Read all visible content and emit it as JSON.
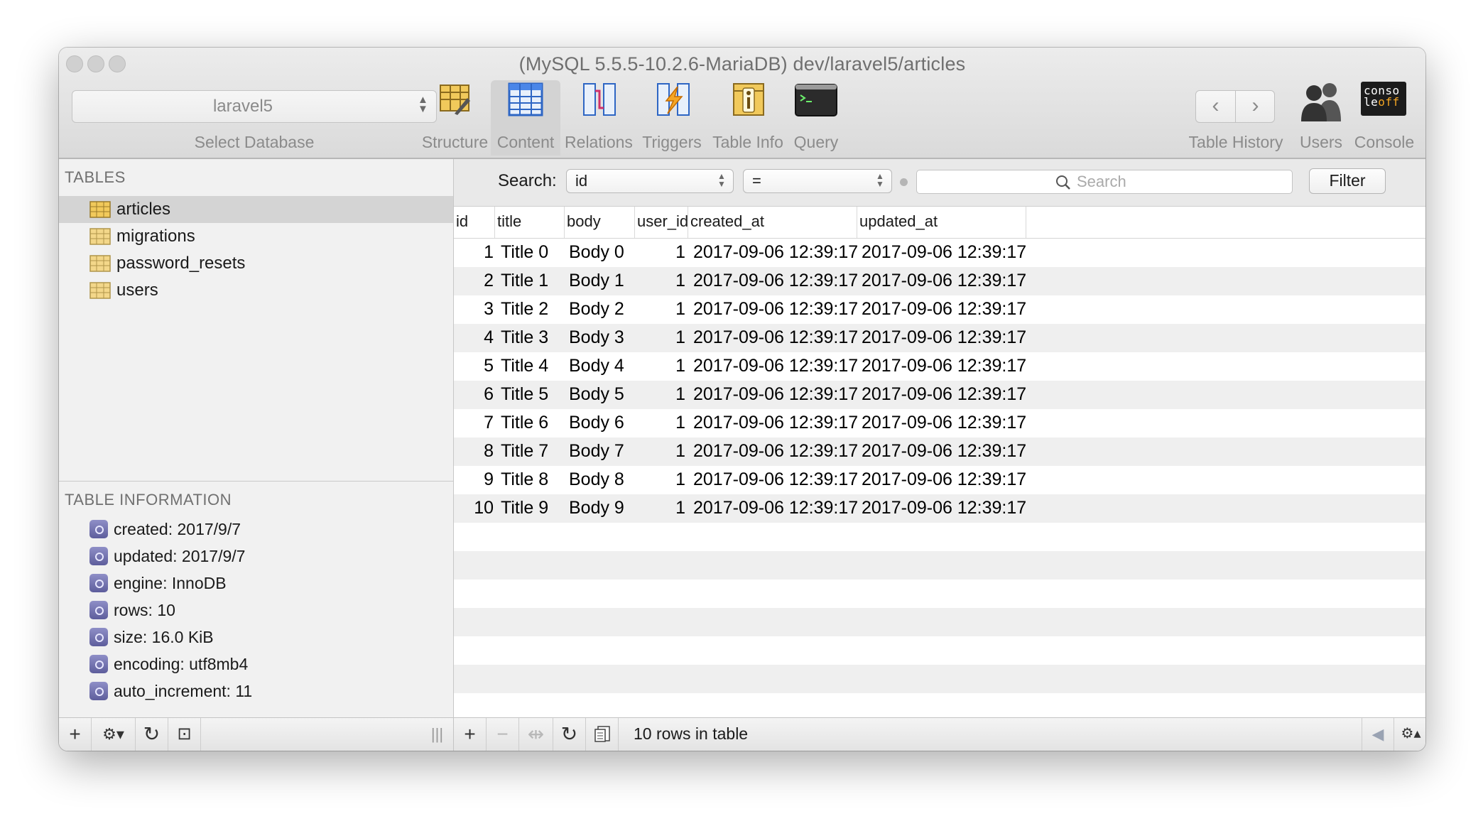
{
  "window": {
    "title": "(MySQL 5.5.5-10.2.6-MariaDB) dev/laravel5/articles"
  },
  "database": {
    "selected": "laravel5",
    "label": "Select Database"
  },
  "toolbar": {
    "items": [
      {
        "label": "Structure",
        "icon": "structure-icon"
      },
      {
        "label": "Content",
        "icon": "content-icon"
      },
      {
        "label": "Relations",
        "icon": "relations-icon"
      },
      {
        "label": "Triggers",
        "icon": "triggers-icon"
      },
      {
        "label": "Table Info",
        "icon": "table-info-icon"
      },
      {
        "label": "Query",
        "icon": "query-icon"
      }
    ],
    "history_label": "Table History",
    "users_label": "Users",
    "console_label": "Console",
    "console_icon_text": "conso le off",
    "active_item": "Content"
  },
  "sidebar": {
    "tables_header": "TABLES",
    "tables": [
      "articles",
      "migrations",
      "password_resets",
      "users"
    ],
    "selected_table": "articles",
    "info_header": "TABLE INFORMATION",
    "info": [
      "created: 2017/9/7",
      "updated: 2017/9/7",
      "engine: InnoDB",
      "rows: 10",
      "size: 16.0 KiB",
      "encoding: utf8mb4",
      "auto_increment: 11"
    ]
  },
  "search": {
    "label": "Search:",
    "field": "id",
    "operator": "=",
    "placeholder": "Search",
    "filter_label": "Filter"
  },
  "grid": {
    "columns": [
      "id",
      "title",
      "body",
      "user_id",
      "created_at",
      "updated_at"
    ],
    "rows": [
      [
        "1",
        "Title 0",
        "Body 0",
        "1",
        "2017-09-06 12:39:17",
        "2017-09-06 12:39:17"
      ],
      [
        "2",
        "Title 1",
        "Body 1",
        "1",
        "2017-09-06 12:39:17",
        "2017-09-06 12:39:17"
      ],
      [
        "3",
        "Title 2",
        "Body 2",
        "1",
        "2017-09-06 12:39:17",
        "2017-09-06 12:39:17"
      ],
      [
        "4",
        "Title 3",
        "Body 3",
        "1",
        "2017-09-06 12:39:17",
        "2017-09-06 12:39:17"
      ],
      [
        "5",
        "Title 4",
        "Body 4",
        "1",
        "2017-09-06 12:39:17",
        "2017-09-06 12:39:17"
      ],
      [
        "6",
        "Title 5",
        "Body 5",
        "1",
        "2017-09-06 12:39:17",
        "2017-09-06 12:39:17"
      ],
      [
        "7",
        "Title 6",
        "Body 6",
        "1",
        "2017-09-06 12:39:17",
        "2017-09-06 12:39:17"
      ],
      [
        "8",
        "Title 7",
        "Body 7",
        "1",
        "2017-09-06 12:39:17",
        "2017-09-06 12:39:17"
      ],
      [
        "9",
        "Title 8",
        "Body 8",
        "1",
        "2017-09-06 12:39:17",
        "2017-09-06 12:39:17"
      ],
      [
        "10",
        "Title 9",
        "Body 9",
        "1",
        "2017-09-06 12:39:17",
        "2017-09-06 12:39:17"
      ]
    ]
  },
  "status": {
    "rows_text": "10 rows in table"
  },
  "bottom": {
    "sidebar_buttons": [
      "+",
      "⚙▾",
      "↻",
      "⊡",
      "|||"
    ],
    "content_buttons": [
      "+",
      "−",
      "⇹",
      "↻"
    ],
    "page_buttons": [
      "◀",
      "⚙▴",
      "▶"
    ]
  },
  "colors": {
    "accent": "#3e78d6",
    "selected_row": "#d4d4d4",
    "alt_row": "#efefef"
  }
}
